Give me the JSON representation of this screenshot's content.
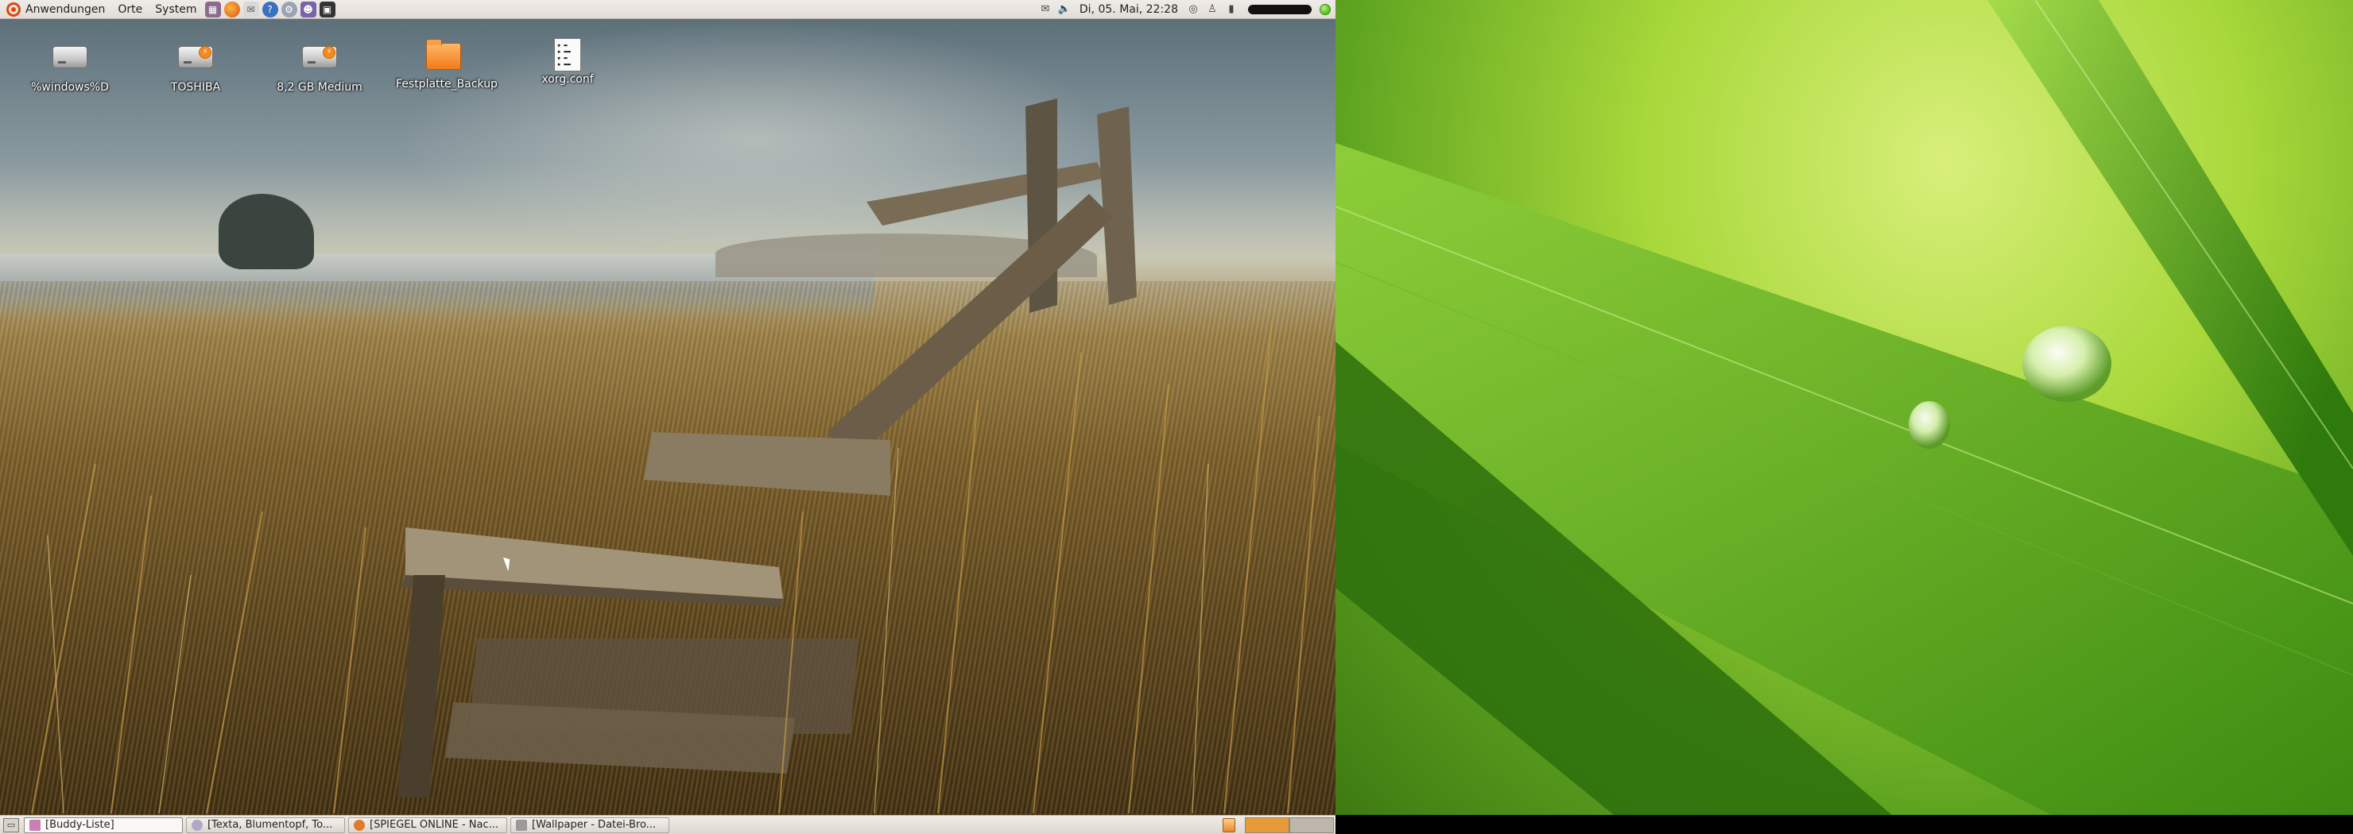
{
  "top_panel": {
    "menus": [
      "Anwendungen",
      "Orte",
      "System"
    ],
    "launchers": [
      "game-icon",
      "firefox-icon",
      "mail-icon",
      "help-icon",
      "settings-icon",
      "pidgin-icon",
      "terminal-icon"
    ],
    "clock": "Di, 05. Mai, 22:28"
  },
  "desktop_icons": [
    {
      "label": "%windows%D",
      "icon": "drive-icon"
    },
    {
      "label": "TOSHIBA",
      "icon": "usb-drive-icon"
    },
    {
      "label": "8,2 GB Medium",
      "icon": "usb-drive-icon"
    },
    {
      "label": "Festplatte_Backup",
      "icon": "folder-icon"
    },
    {
      "label": "xorg.conf",
      "icon": "text-file-icon"
    }
  ],
  "taskbar": {
    "tasks": [
      {
        "label": "[Buddy-Liste]",
        "icon_color": "#c87fb4"
      },
      {
        "label": "[Texta, Blumentopf, To...",
        "icon_color": "#b0a8c8"
      },
      {
        "label": "[SPIEGEL ONLINE - Nac...",
        "icon_color": "#e07a2e"
      },
      {
        "label": "[Wallpaper - Datei-Bro...",
        "icon_color": "#9a9a9a"
      }
    ]
  },
  "colors": {
    "ubuntu_orange": "#dd4814",
    "panel_bg": "#e6e1da",
    "workspace_active": "#e79a3a"
  }
}
